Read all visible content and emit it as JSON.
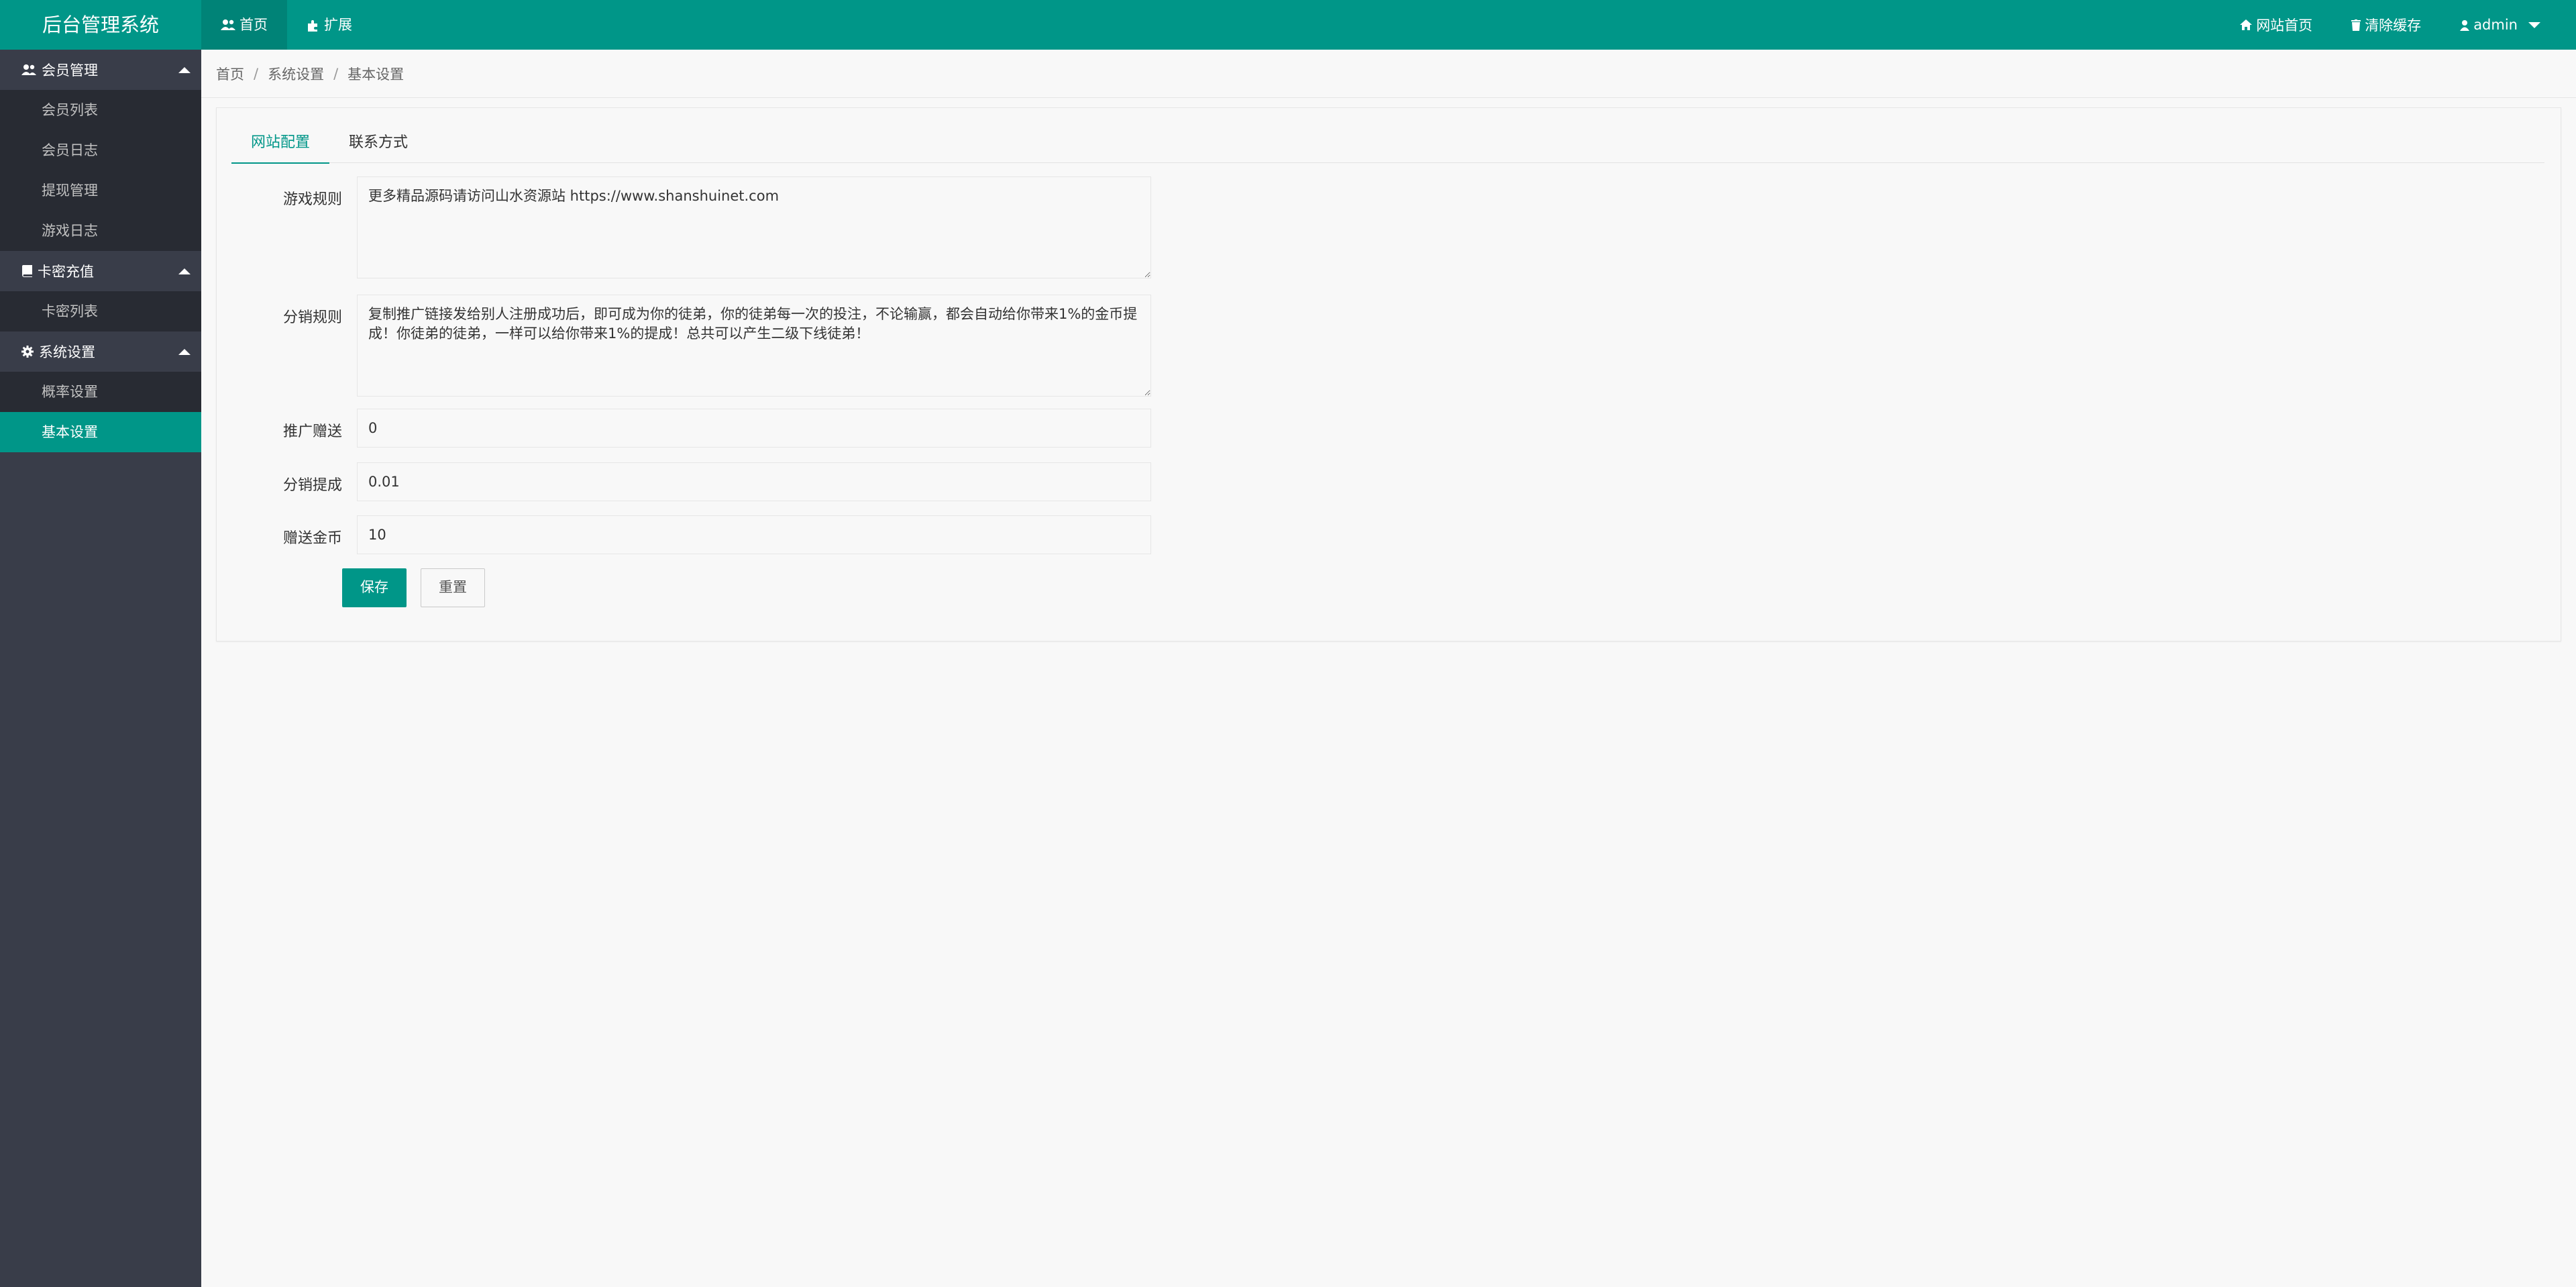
{
  "header": {
    "logo": "后台管理系统",
    "nav": [
      {
        "label": "首页",
        "icon": "users-icon"
      },
      {
        "label": "扩展",
        "icon": "puzzle-icon"
      }
    ],
    "right": [
      {
        "label": "网站首页",
        "icon": "home-icon"
      },
      {
        "label": "清除缓存",
        "icon": "trash-icon"
      },
      {
        "label": "admin",
        "icon": "user-icon"
      }
    ]
  },
  "sidebar": {
    "groups": [
      {
        "title": "会员管理",
        "icon": "users-icon",
        "items": [
          "会员列表",
          "会员日志",
          "提现管理",
          "游戏日志"
        ]
      },
      {
        "title": "卡密充值",
        "icon": "book-icon",
        "items": [
          "卡密列表"
        ]
      },
      {
        "title": "系统设置",
        "icon": "gear-icon",
        "items": [
          "概率设置",
          "基本设置"
        ]
      }
    ],
    "active_item": "基本设置"
  },
  "breadcrumb": [
    "首页",
    "系统设置",
    "基本设置"
  ],
  "tabs": [
    "网站配置",
    "联系方式"
  ],
  "form": {
    "game_rules_label": "游戏规则",
    "game_rules_value": "更多精品源码请访问山水资源站 https://www.shanshuinet.com",
    "distribution_rules_label": "分销规则",
    "distribution_rules_value": "复制推广链接发给别人注册成功后，即可成为你的徒弟，你的徒弟每一次的投注，不论输赢，都会自动给你带来1%的金币提成！你徒弟的徒弟，一样可以给你带来1%的提成！总共可以产生二级下线徒弟！",
    "promo_gift_label": "推广赠送",
    "promo_gift_value": "0",
    "distribution_commission_label": "分销提成",
    "distribution_commission_value": "0.01",
    "gift_coins_label": "赠送金币",
    "gift_coins_value": "10",
    "save_label": "保存",
    "reset_label": "重置"
  },
  "colors": {
    "accent": "#009688",
    "sidebar_bg": "#393d49",
    "sidebar_child_bg": "#282b33"
  }
}
